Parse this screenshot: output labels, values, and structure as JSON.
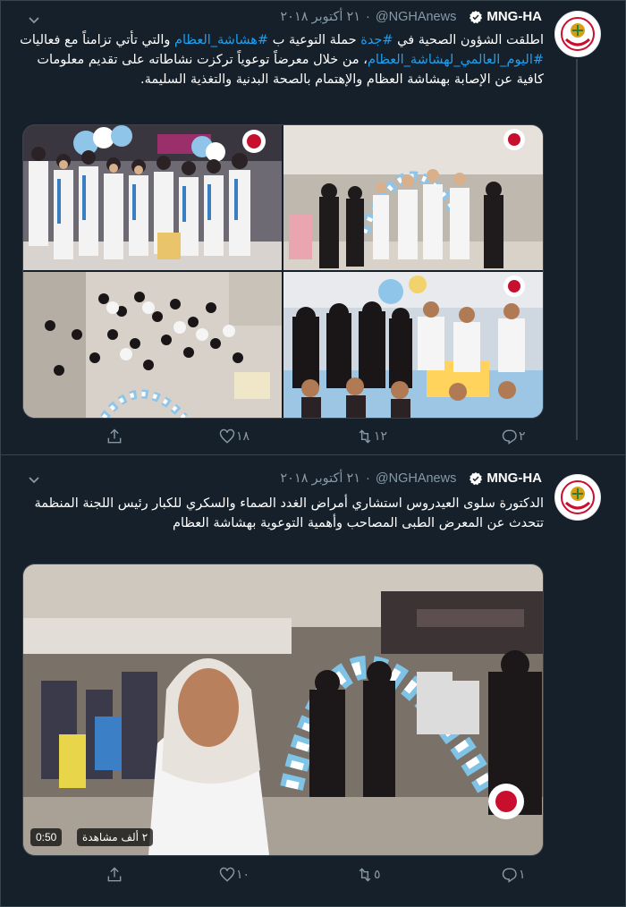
{
  "tweets": [
    {
      "display_name": "MNG-HA",
      "handle": "@NGHAnews",
      "separator": "·",
      "date": "٢١ أكتوبر ٢٠١٨",
      "text_parts": [
        "اطلقت الشؤون الصحية في ",
        "#جدة",
        " حملة التوعية ب ",
        "#هشاشة_العظام",
        " والتي تأتي تزامناً مع فعاليات ",
        "#اليوم_العالمي_لهشاشة_العظام",
        "، من خلال معرضاً توعوياً تركزت نشاطاته على تقديم معلومات كافية عن الإصابة بهشاشة العظام والإهتمام بالصحة البدنية والتغذية السليمة."
      ],
      "reply_count": "٢",
      "retweet_count": "١٢",
      "like_count": "١٨"
    },
    {
      "display_name": "MNG-HA",
      "handle": "@NGHAnews",
      "separator": "·",
      "date": "٢١ أكتوبر ٢٠١٨",
      "text": "الدكتورة سلوى العيدروس استشاري أمراض الغدد الصماء والسكري للكبار رئيس اللجنة المنظمة تتحدث عن المعرض الطبى المصاحب وأهمية التوعوية بهشاشة العظام",
      "video_duration": "0:50",
      "video_views": "٢ ألف مشاهدة",
      "reply_count": "١",
      "retweet_count": "٥",
      "like_count": "١٠"
    }
  ],
  "colors": {
    "background": "#15202b",
    "link": "#1da1f2",
    "muted": "#8899a6",
    "border": "#38444d"
  },
  "icons": {
    "verified": "verified-badge-icon",
    "menu": "chevron-down-icon",
    "reply": "reply-icon",
    "retweet": "retweet-icon",
    "like": "heart-icon",
    "share": "share-icon",
    "avatar": "ngha-logo"
  }
}
